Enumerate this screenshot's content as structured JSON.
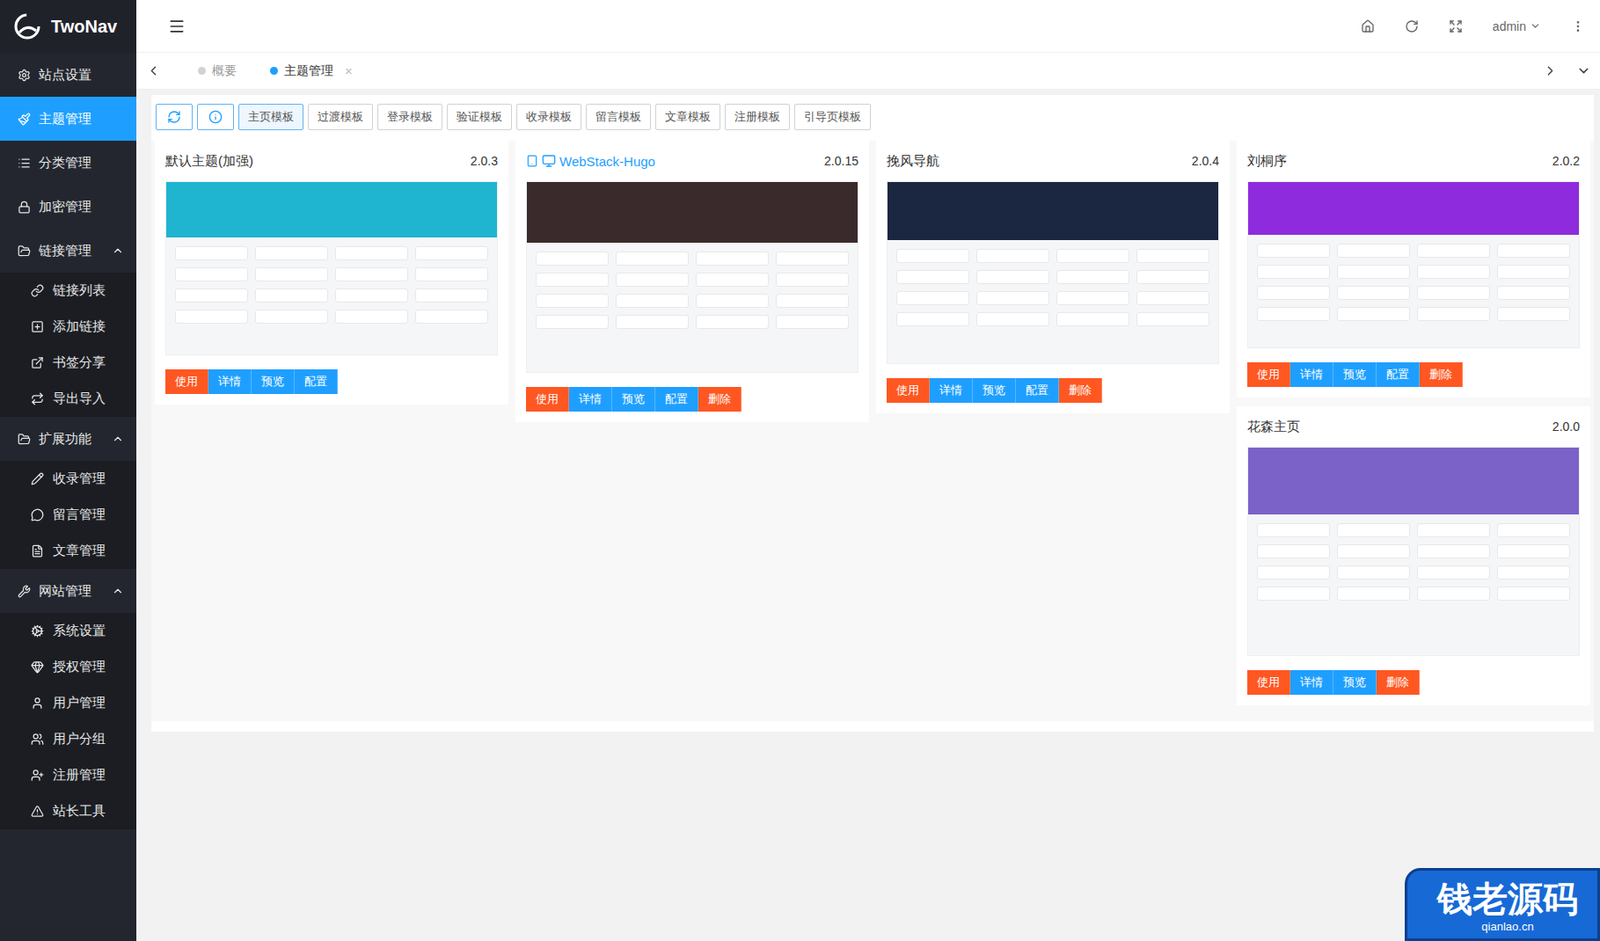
{
  "app": {
    "name": "TwoNav"
  },
  "header": {
    "user": "admin"
  },
  "sidebar": {
    "items": [
      {
        "label": "站点设置",
        "kind": "item",
        "selected": false,
        "expanded": false
      },
      {
        "label": "主题管理",
        "kind": "item",
        "selected": true,
        "expanded": false
      },
      {
        "label": "分类管理",
        "kind": "item",
        "selected": false,
        "expanded": false
      },
      {
        "label": "加密管理",
        "kind": "item",
        "selected": false,
        "expanded": false
      },
      {
        "label": "链接管理",
        "kind": "group",
        "selected": false,
        "expanded": true
      },
      {
        "label": "链接列表",
        "kind": "sub",
        "selected": false,
        "expanded": false
      },
      {
        "label": "添加链接",
        "kind": "sub",
        "selected": false,
        "expanded": false
      },
      {
        "label": "书签分享",
        "kind": "sub",
        "selected": false,
        "expanded": false
      },
      {
        "label": "导出导入",
        "kind": "sub",
        "selected": false,
        "expanded": false
      },
      {
        "label": "扩展功能",
        "kind": "group",
        "selected": false,
        "expanded": true
      },
      {
        "label": "收录管理",
        "kind": "sub",
        "selected": false,
        "expanded": false
      },
      {
        "label": "留言管理",
        "kind": "sub",
        "selected": false,
        "expanded": false
      },
      {
        "label": "文章管理",
        "kind": "sub",
        "selected": false,
        "expanded": false
      },
      {
        "label": "网站管理",
        "kind": "group",
        "selected": false,
        "expanded": true
      },
      {
        "label": "系统设置",
        "kind": "sub",
        "selected": false,
        "expanded": false
      },
      {
        "label": "授权管理",
        "kind": "sub",
        "selected": false,
        "expanded": false
      },
      {
        "label": "用户管理",
        "kind": "sub",
        "selected": false,
        "expanded": false
      },
      {
        "label": "用户分组",
        "kind": "sub",
        "selected": false,
        "expanded": false
      },
      {
        "label": "注册管理",
        "kind": "sub",
        "selected": false,
        "expanded": false
      },
      {
        "label": "站长工具",
        "kind": "sub",
        "selected": false,
        "expanded": false
      }
    ]
  },
  "tabs": {
    "close": "×",
    "items": [
      {
        "label": "概要",
        "selected": false,
        "closable": false
      },
      {
        "label": "主题管理",
        "selected": true,
        "closable": true
      }
    ]
  },
  "toolbar": {
    "templates": [
      {
        "label": "主页模板",
        "selected": true
      },
      {
        "label": "过渡模板",
        "selected": false
      },
      {
        "label": "登录模板",
        "selected": false
      },
      {
        "label": "验证模板",
        "selected": false
      },
      {
        "label": "收录模板",
        "selected": false
      },
      {
        "label": "留言模板",
        "selected": false
      },
      {
        "label": "文章模板",
        "selected": false
      },
      {
        "label": "注册模板",
        "selected": false
      },
      {
        "label": "引导页模板",
        "selected": false
      }
    ]
  },
  "themes": [
    {
      "title": "默认主题(加强)",
      "version": "2.0.3",
      "in_use": false,
      "color": "#1fb5d0",
      "buttons": [
        {
          "label": "使用",
          "color": "#ff5722"
        },
        {
          "label": "详情",
          "color": "#1e9fff"
        },
        {
          "label": "预览",
          "color": "#1e9fff"
        },
        {
          "label": "配置",
          "color": "#1e9fff"
        }
      ]
    },
    {
      "title": "WebStack-Hugo",
      "version": "2.0.15",
      "in_use": true,
      "color": "#3b2a2c",
      "buttons": [
        {
          "label": "使用",
          "color": "#ff5722"
        },
        {
          "label": "详情",
          "color": "#1e9fff"
        },
        {
          "label": "预览",
          "color": "#1e9fff"
        },
        {
          "label": "配置",
          "color": "#1e9fff"
        },
        {
          "label": "删除",
          "color": "#ff5722"
        }
      ]
    },
    {
      "title": "挽风导航",
      "version": "2.0.4",
      "in_use": false,
      "color": "#1b2640",
      "buttons": [
        {
          "label": "使用",
          "color": "#ff5722"
        },
        {
          "label": "详情",
          "color": "#1e9fff"
        },
        {
          "label": "预览",
          "color": "#1e9fff"
        },
        {
          "label": "配置",
          "color": "#1e9fff"
        },
        {
          "label": "删除",
          "color": "#ff5722"
        }
      ]
    },
    {
      "title": "刘桐序",
      "version": "2.0.2",
      "in_use": false,
      "color": "#8e2bdc",
      "buttons": [
        {
          "label": "使用",
          "color": "#ff5722"
        },
        {
          "label": "详情",
          "color": "#1e9fff"
        },
        {
          "label": "预览",
          "color": "#1e9fff"
        },
        {
          "label": "配置",
          "color": "#1e9fff"
        },
        {
          "label": "删除",
          "color": "#ff5722"
        }
      ]
    },
    {
      "title": "花森主页",
      "version": "2.0.0",
      "in_use": false,
      "color": "#7a62c9",
      "buttons": [
        {
          "label": "使用",
          "color": "#ff5722"
        },
        {
          "label": "详情",
          "color": "#1e9fff"
        },
        {
          "label": "预览",
          "color": "#1e9fff"
        },
        {
          "label": "删除",
          "color": "#ff5722"
        }
      ]
    }
  ],
  "watermark": {
    "title": "钱老源码",
    "url": "qianlao.cn"
  }
}
